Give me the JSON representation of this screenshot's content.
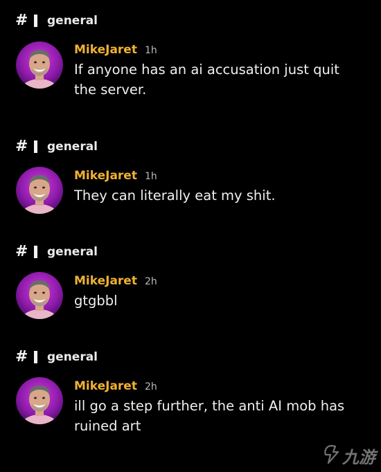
{
  "accent": "#f0b232",
  "messages": [
    {
      "channel_icon": "hashtag-icon",
      "channel": "general",
      "author": "MikeJaret",
      "author_color": "#f0b232",
      "time": "1h",
      "text": "If anyone has an ai accusation just quit the server."
    },
    {
      "channel_icon": "hashtag-icon",
      "channel": "general",
      "author": "MikeJaret",
      "author_color": "#f0b232",
      "time": "1h",
      "text": "They can literally eat my shit."
    },
    {
      "channel_icon": "hashtag-icon",
      "channel": "general",
      "author": "MikeJaret",
      "author_color": "#f0b232",
      "time": "2h",
      "text": "gtgbbl"
    },
    {
      "channel_icon": "hashtag-icon",
      "channel": "general",
      "author": "MikeJaret",
      "author_color": "#f0b232",
      "time": "2h",
      "text": "ill go a step further, the anti AI mob has ruined art"
    }
  ],
  "watermark": {
    "text": "九游",
    "icon": "watermark-logo-icon"
  }
}
